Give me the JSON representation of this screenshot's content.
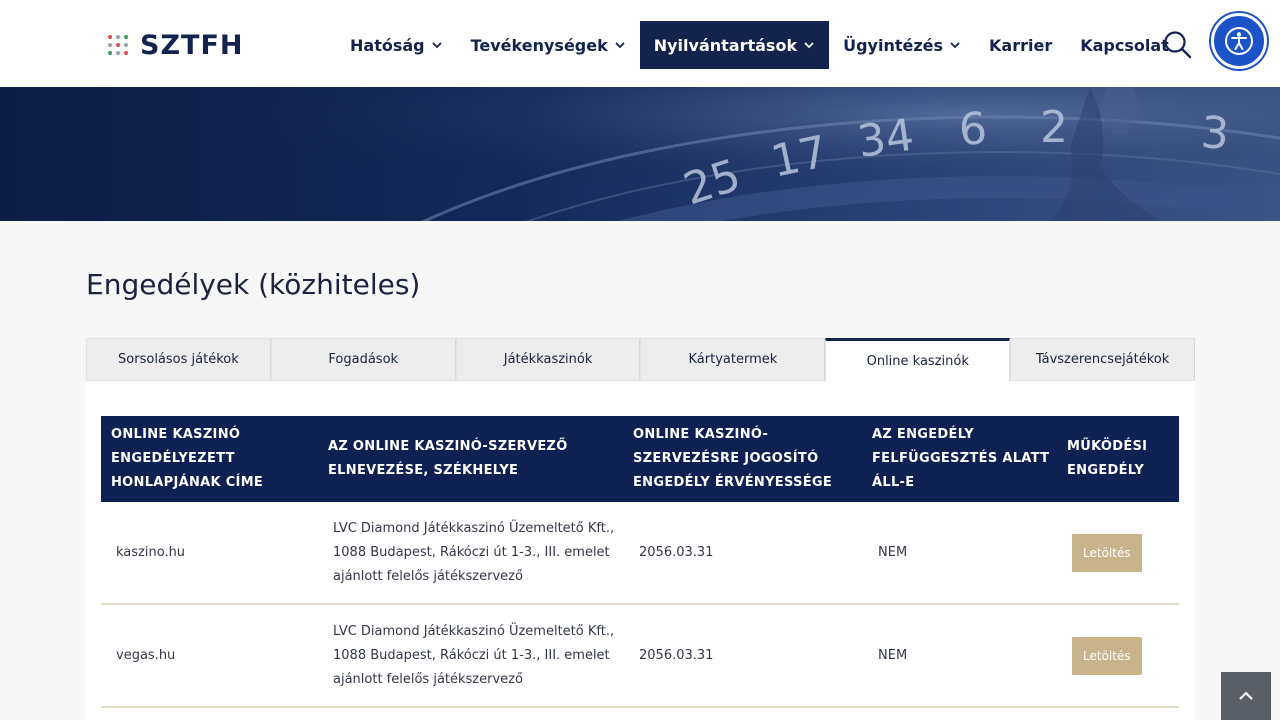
{
  "brand": {
    "logo_text": "SZTFH",
    "dot_colors": [
      "#d9534f",
      "#9aa0a8",
      "#3aa15a",
      "#9aa0a8",
      "#d9534f",
      "#9aa0a8",
      "#3aa15a",
      "#9aa0a8",
      "#d9534f"
    ]
  },
  "nav": {
    "items": [
      {
        "label": "Hatóság",
        "dropdown": true
      },
      {
        "label": "Tevékenységek",
        "dropdown": true
      },
      {
        "label": "Nyilvántartások",
        "dropdown": true,
        "active": true
      },
      {
        "label": "Ügyintézés",
        "dropdown": true
      },
      {
        "label": "Karrier",
        "dropdown": false
      },
      {
        "label": "Kapcsolat",
        "dropdown": false
      }
    ],
    "search_icon": "search-icon",
    "accessibility_icon": "accessibility-icon"
  },
  "hero": {
    "numbers": [
      "25",
      "17",
      "34",
      "6",
      "2",
      "3"
    ]
  },
  "page": {
    "title": "Engedélyek (közhiteles)"
  },
  "tabs": [
    {
      "label": "Sorsolásos játékok"
    },
    {
      "label": "Fogadások"
    },
    {
      "label": "Játékkaszinók"
    },
    {
      "label": "Kártyatermek"
    },
    {
      "label": "Online kaszinók",
      "active": true
    },
    {
      "label": "Távszerencsejátékok"
    }
  ],
  "table": {
    "headers": [
      "Online kaszinó engedélyezett honlapjának címe",
      "Az online kaszinó-szervező elnevezése, székhelye",
      "Online kaszinó-szervezésre jogosító engedély érvényessége",
      "Az engedély felfüggesztés alatt áll-e",
      "Működési engedély"
    ],
    "rows": [
      {
        "site": "kaszino.hu",
        "organizer": "LVC Diamond Játékkaszinó Üzemeltető Kft., 1088 Budapest, Rákóczi út 1-3., III. emelet ajánlott felelős játékszervező",
        "validity": "2056.03.31",
        "suspended": "NEM",
        "download": "Letöltés"
      },
      {
        "site": "vegas.hu",
        "organizer": "LVC Diamond Játékkaszinó Üzemeltető Kft., 1088 Budapest, Rákóczi út 1-3., III. emelet ajánlott felelős játékszervező",
        "validity": "2056.03.31",
        "suspended": "NEM",
        "download": "Letöltés"
      }
    ]
  },
  "colors": {
    "navy": "#14234d",
    "table_header": "#0f2152",
    "download_button": "#c8b48a",
    "accessibility_button": "#1c53c9"
  }
}
